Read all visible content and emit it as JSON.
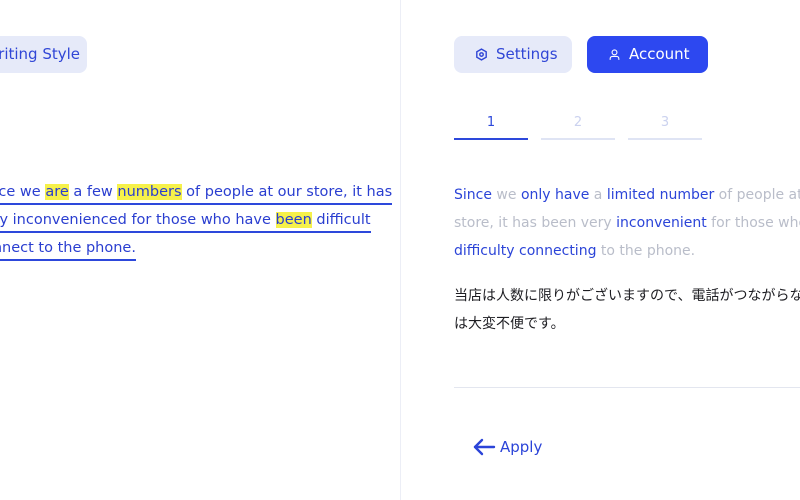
{
  "left": {
    "writing_style_label": "Writing Style",
    "lines": [
      {
        "parts": [
          {
            "t": "Since we ",
            "hl": false
          },
          {
            "t": "are",
            "hl": true
          },
          {
            "t": " a few ",
            "hl": false
          },
          {
            "t": "numbers",
            "hl": true
          },
          {
            "t": " of people at our store, it has",
            "hl": false
          }
        ]
      },
      {
        "parts": [
          {
            "t": "very inconvenienced for those who have ",
            "hl": false
          },
          {
            "t": "been",
            "hl": true
          },
          {
            "t": " difficult",
            "hl": false
          }
        ]
      },
      {
        "parts": [
          {
            "t": "connect to the phone.",
            "hl": false
          }
        ]
      }
    ]
  },
  "header": {
    "settings_label": "Settings",
    "account_label": "Account",
    "settings_icon": "gear-icon",
    "account_icon": "user-icon"
  },
  "steps": [
    {
      "label": "1",
      "active": true
    },
    {
      "label": "2",
      "active": false
    },
    {
      "label": "3",
      "active": false
    }
  ],
  "suggestion": {
    "lines": [
      [
        {
          "t": "Since",
          "k": true
        },
        {
          "t": " we ",
          "k": false
        },
        {
          "t": "only have",
          "k": true
        },
        {
          "t": " a ",
          "k": false
        },
        {
          "t": "limited number",
          "k": true
        },
        {
          "t": " of people at our",
          "k": false
        }
      ],
      [
        {
          "t": "store, it has been very ",
          "k": false
        },
        {
          "t": "inconvenient",
          "k": true
        },
        {
          "t": " for those who have",
          "k": false
        }
      ],
      [
        {
          "t": "difficulty connecting",
          "k": true
        },
        {
          "t": " to the phone.",
          "k": false
        }
      ]
    ]
  },
  "japanese": {
    "line1": "当店は人数に限りがございますので、電話がつながらない",
    "line2": "は大変不便です。"
  },
  "footer": {
    "apply_label": "Apply",
    "apply_icon": "arrow-left-icon"
  },
  "colors": {
    "accent": "#2d48f0",
    "accent_text": "#2b44d8",
    "soft_button": "#e6eaf9",
    "highlight": "#f6f14a",
    "muted_text": "#b9bdc9"
  }
}
